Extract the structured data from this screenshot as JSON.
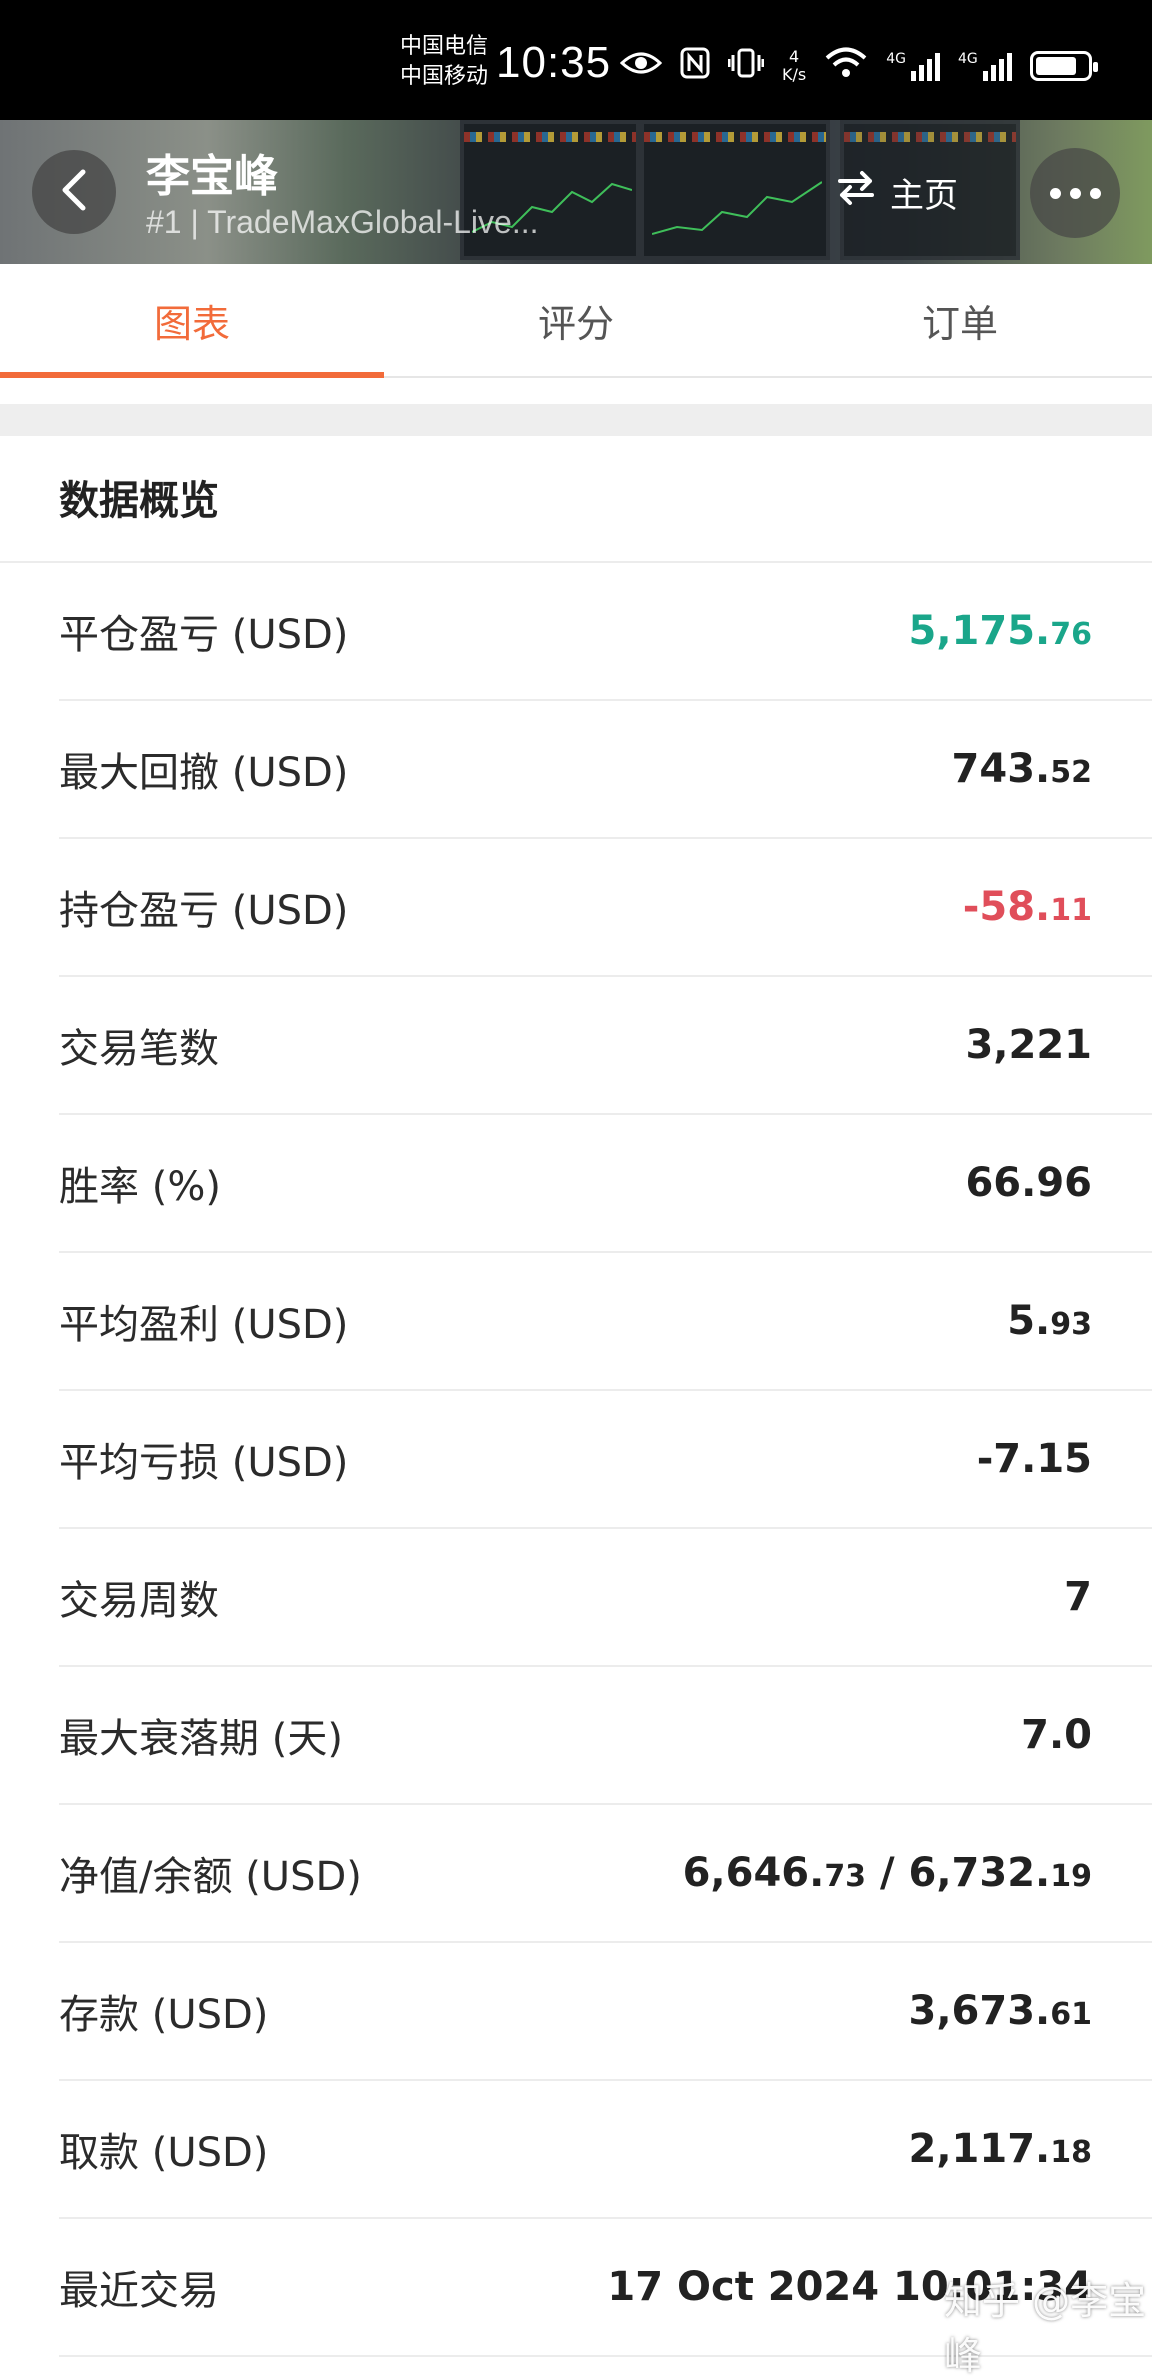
{
  "status_bar": {
    "carrier_1": "中国电信",
    "carrier_2": "中国移动",
    "time": "10:35",
    "speed_value": "4",
    "speed_unit": "K/s",
    "net_1": "4G",
    "net_2": "4G",
    "battery_level": 0.8
  },
  "header": {
    "name": "李宝峰",
    "subtitle": "#1 | TradeMaxGlobal-Live...",
    "home_label": "主页"
  },
  "tabs": [
    {
      "label": "图表",
      "active": true
    },
    {
      "label": "评分",
      "active": false
    },
    {
      "label": "订单",
      "active": false
    }
  ],
  "overview": {
    "title": "数据概览",
    "rows": [
      {
        "label": "平仓盈亏 (USD)",
        "value_main": "5,175.",
        "value_small": "76",
        "color": "#1aa68a"
      },
      {
        "label": "最大回撤 (USD)",
        "value_main": "743.",
        "value_small": "52",
        "color": "#222222"
      },
      {
        "label": "持仓盈亏 (USD)",
        "value_main": "-58.",
        "value_small": "11",
        "color": "#e04e5a"
      },
      {
        "label": "交易笔数",
        "value_main": "3,221",
        "value_small": "",
        "color": "#222222"
      },
      {
        "label": "胜率 (%)",
        "value_main": "66.96",
        "value_small": "",
        "color": "#222222"
      },
      {
        "label": "平均盈利 (USD)",
        "value_main": "5.",
        "value_small": "93",
        "color": "#222222"
      },
      {
        "label": "平均亏损 (USD)",
        "value_main": "-7.15",
        "value_small": "",
        "color": "#222222"
      },
      {
        "label": "交易周数",
        "value_main": "7",
        "value_small": "",
        "color": "#222222"
      },
      {
        "label": "最大衰落期 (天)",
        "value_main": "7.0",
        "value_small": "",
        "color": "#222222"
      },
      {
        "label": "净值/余额 (USD)",
        "value_main": "6,646.",
        "value_small": "73",
        "value_main_2": " / 6,732.",
        "value_small_2": "19",
        "color": "#222222"
      },
      {
        "label": "存款 (USD)",
        "value_main": "3,673.",
        "value_small": "61",
        "color": "#222222"
      },
      {
        "label": "取款 (USD)",
        "value_main": "2,117.",
        "value_small": "18",
        "color": "#222222"
      },
      {
        "label": "最近交易",
        "value_main": "17 Oct 2024 10:01:34",
        "value_small": "",
        "color": "#222222"
      }
    ]
  },
  "watermark": "知乎 @李宝峰",
  "colors": {
    "accent": "#f26b3a",
    "profit": "#1aa68a",
    "loss": "#e04e5a"
  }
}
